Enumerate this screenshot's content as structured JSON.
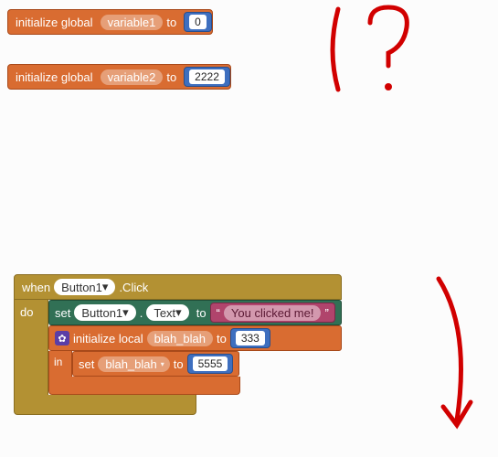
{
  "globals": [
    {
      "label_prefix": "initialize global",
      "name": "variable1",
      "label_suffix": "to",
      "value": "0"
    },
    {
      "label_prefix": "initialize global",
      "name": "variable2",
      "label_suffix": "to",
      "value": "2222"
    }
  ],
  "event": {
    "when_label": "when",
    "component": "Button1",
    "event_name": ".Click",
    "do_label": "do"
  },
  "set_text": {
    "set_label": "set",
    "component": "Button1",
    "dot": ".",
    "prop": "Text",
    "to_label": "to",
    "quote_open": "“",
    "value": "You clicked me!",
    "quote_close": "”"
  },
  "local": {
    "init_label": "initialize local",
    "name": "blah_blah",
    "to_label": "to",
    "value": "333",
    "in_label": "in"
  },
  "set_local": {
    "set_label": "set",
    "name": "blah_blah",
    "to_label": "to",
    "value": "5555"
  }
}
